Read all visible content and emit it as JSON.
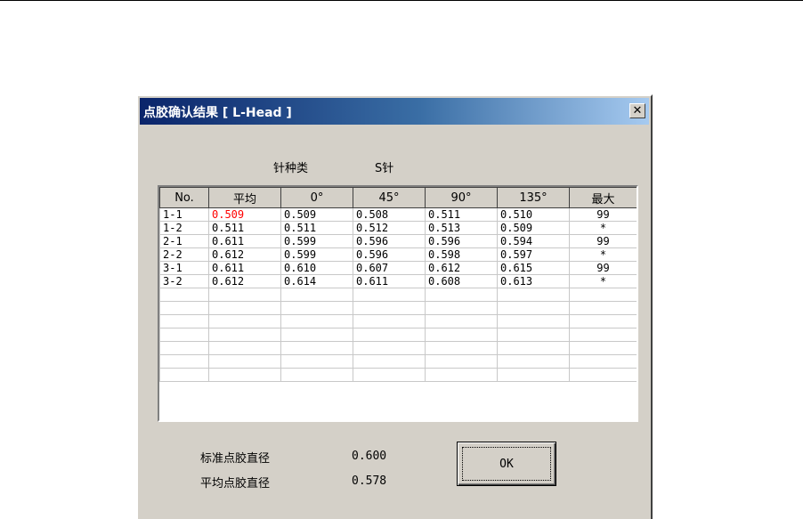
{
  "dialog": {
    "title": "点胶确认结果 [ L-Head ]",
    "close_glyph": "✕"
  },
  "needle": {
    "label": "针种类",
    "value": "S针"
  },
  "grid": {
    "headers": [
      "No.",
      "平均",
      "0°",
      "45°",
      "90°",
      "135°",
      "最大"
    ],
    "rows": [
      [
        "1-1",
        "0.509",
        "0.509",
        "0.508",
        "0.511",
        "0.510",
        "99"
      ],
      [
        "1-2",
        "0.511",
        "0.511",
        "0.512",
        "0.513",
        "0.509",
        "*"
      ],
      [
        "2-1",
        "0.611",
        "0.599",
        "0.596",
        "0.596",
        "0.594",
        "99"
      ],
      [
        "2-2",
        "0.612",
        "0.599",
        "0.596",
        "0.598",
        "0.597",
        "*"
      ],
      [
        "3-1",
        "0.611",
        "0.610",
        "0.607",
        "0.612",
        "0.615",
        "99"
      ],
      [
        "3-2",
        "0.612",
        "0.614",
        "0.611",
        "0.608",
        "0.613",
        "*"
      ]
    ],
    "empty_rows": 7,
    "highlight_color": "#ff0000"
  },
  "summary": {
    "standard_label": "标准点胶直径",
    "standard_value": "0.600",
    "average_label": "平均点胶直径",
    "average_value": "0.578"
  },
  "ok_button": {
    "label": "OK"
  }
}
